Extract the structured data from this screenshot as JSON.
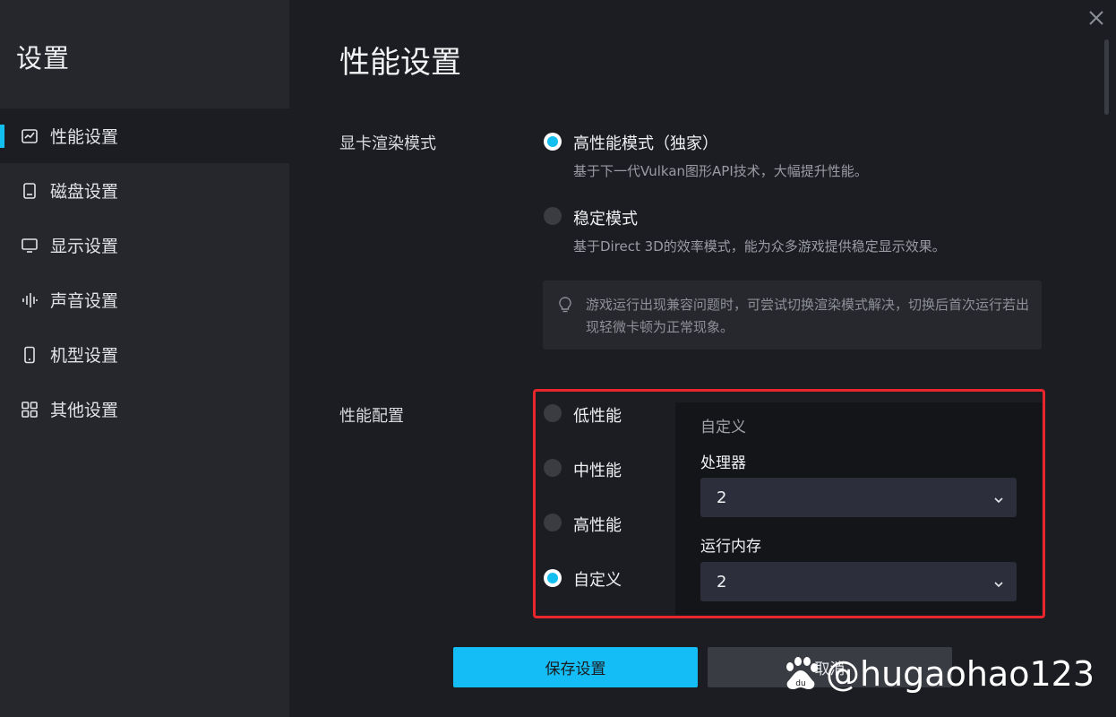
{
  "sidebar": {
    "title": "设置",
    "items": [
      {
        "label": "性能设置",
        "icon": "performance-chart-icon",
        "active": true
      },
      {
        "label": "磁盘设置",
        "icon": "disk-icon",
        "active": false
      },
      {
        "label": "显示设置",
        "icon": "monitor-icon",
        "active": false
      },
      {
        "label": "声音设置",
        "icon": "sound-wave-icon",
        "active": false
      },
      {
        "label": "机型设置",
        "icon": "phone-icon",
        "active": false
      },
      {
        "label": "其他设置",
        "icon": "grid-icon",
        "active": false
      }
    ]
  },
  "main": {
    "title": "性能设置",
    "render": {
      "label": "显卡渲染模式",
      "options": [
        {
          "label": "高性能模式（独家）",
          "desc": "基于下一代Vulkan图形API技术，大幅提升性能。",
          "checked": true
        },
        {
          "label": "稳定模式",
          "desc": "基于Direct 3D的效率模式，能为众多游戏提供稳定显示效果。",
          "checked": false
        }
      ],
      "hint": "游戏运行出现兼容问题时，可尝试切换渲染模式解决，切换后首次运行若出现轻微卡顿为正常现象。"
    },
    "perf": {
      "label": "性能配置",
      "options": [
        {
          "label": "低性能",
          "checked": false
        },
        {
          "label": "中性能",
          "checked": false
        },
        {
          "label": "高性能",
          "checked": false
        },
        {
          "label": "自定义",
          "checked": true
        }
      ],
      "custom": {
        "title": "自定义",
        "cpu_label": "处理器",
        "cpu_value": "2",
        "ram_label": "运行内存",
        "ram_value": "2"
      }
    },
    "buttons": {
      "save": "保存设置",
      "cancel": "取消"
    }
  },
  "watermark": "@hugaohao123",
  "colors": {
    "accent": "#13bff0",
    "highlight": "#e8262b"
  }
}
